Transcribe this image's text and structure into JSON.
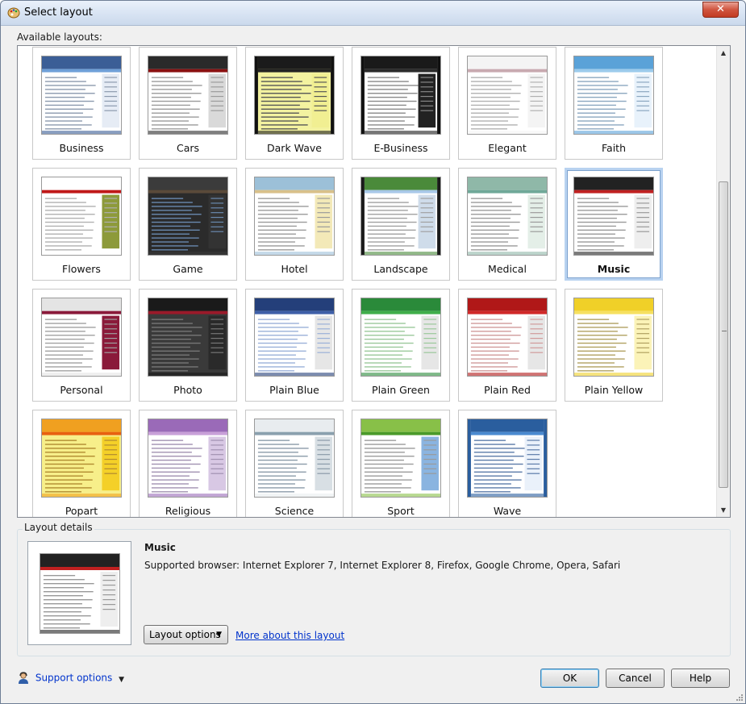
{
  "window": {
    "title": "Select layout",
    "close_symbol": "✕"
  },
  "gallery": {
    "label": "Available layouts:",
    "selected": "Music",
    "items": [
      {
        "name": "Business",
        "style": "business"
      },
      {
        "name": "Cars",
        "style": "cars"
      },
      {
        "name": "Dark Wave",
        "style": "darkwave"
      },
      {
        "name": "E-Business",
        "style": "ebusiness"
      },
      {
        "name": "Elegant",
        "style": "elegant"
      },
      {
        "name": "Faith",
        "style": "faith"
      },
      {
        "name": "Flowers",
        "style": "flowers"
      },
      {
        "name": "Game",
        "style": "game"
      },
      {
        "name": "Hotel",
        "style": "hotel"
      },
      {
        "name": "Landscape",
        "style": "landscape"
      },
      {
        "name": "Medical",
        "style": "medical"
      },
      {
        "name": "Music",
        "style": "music"
      },
      {
        "name": "Personal",
        "style": "personal"
      },
      {
        "name": "Photo",
        "style": "photo"
      },
      {
        "name": "Plain Blue",
        "style": "plainblue"
      },
      {
        "name": "Plain Green",
        "style": "plaingreen"
      },
      {
        "name": "Plain Red",
        "style": "plainred"
      },
      {
        "name": "Plain Yellow",
        "style": "plainyellow"
      },
      {
        "name": "Popart",
        "style": "popart"
      },
      {
        "name": "Religious",
        "style": "religious"
      },
      {
        "name": "Science",
        "style": "science"
      },
      {
        "name": "Sport",
        "style": "sport"
      },
      {
        "name": "Wave",
        "style": "wave"
      }
    ]
  },
  "details": {
    "legend": "Layout details",
    "layout_name": "Music",
    "supported_browsers": "Supported browser: Internet Explorer 7, Internet Explorer 8, Firefox, Google Chrome, Opera, Safari",
    "layout_options_label": "Layout options",
    "more_link": "More about this layout"
  },
  "footer": {
    "support_options": "Support options",
    "ok": "OK",
    "cancel": "Cancel",
    "help": "Help"
  },
  "icons": {
    "app": "palette-icon",
    "support": "user-support-icon",
    "dropdown": "chevron-down-icon"
  },
  "colors": {
    "selection_border": "#b8d2f0",
    "link": "#0033cc",
    "close_button": "#c23b22"
  }
}
